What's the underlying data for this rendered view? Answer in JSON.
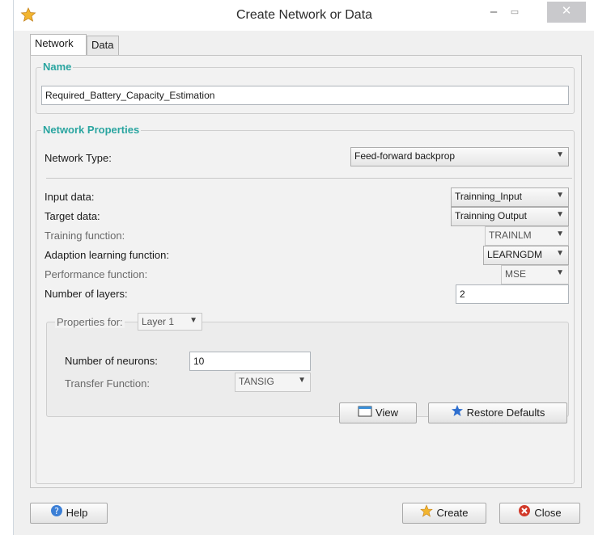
{
  "window": {
    "title": "Create Network or Data",
    "icon": "app-star-icon",
    "controls": {
      "minimize": "–",
      "maximize": "▭",
      "close": "✕"
    }
  },
  "tabs": [
    {
      "label": "Network",
      "active": true
    },
    {
      "label": "Data",
      "active": false
    }
  ],
  "name_group": {
    "legend": "Name",
    "value": "Required_Battery_Capacity_Estimation"
  },
  "network_properties": {
    "legend": "Network Properties",
    "network_type": {
      "label": "Network Type:",
      "value": "Feed-forward backprop"
    },
    "input_data": {
      "label": "Input data:",
      "value": "Trainning_Input"
    },
    "target_data": {
      "label": "Target data:",
      "value": "Trainning Output"
    },
    "training_function": {
      "label": "Training function:",
      "value": "TRAINLM"
    },
    "adaption_function": {
      "label": "Adaption learning function:",
      "value": "LEARNGDM"
    },
    "performance_function": {
      "label": "Performance function:",
      "value": "MSE"
    },
    "number_of_layers": {
      "label": "Number of layers:",
      "value": "2"
    },
    "layer_properties": {
      "label": "Properties for:",
      "layer": "Layer 1",
      "neurons_label": "Number of neurons:",
      "neurons_value": "10",
      "transfer_label": "Transfer Function:",
      "transfer_value": "TANSIG"
    }
  },
  "buttons": {
    "view": "View",
    "restore": "Restore Defaults",
    "help": "Help",
    "create": "Create",
    "close": "Close"
  },
  "colors": {
    "legend": "#2aa5a0",
    "close_icon": "#d23a2a",
    "help_icon": "#3b7fd6",
    "restore_icon": "#2f6fcf"
  }
}
